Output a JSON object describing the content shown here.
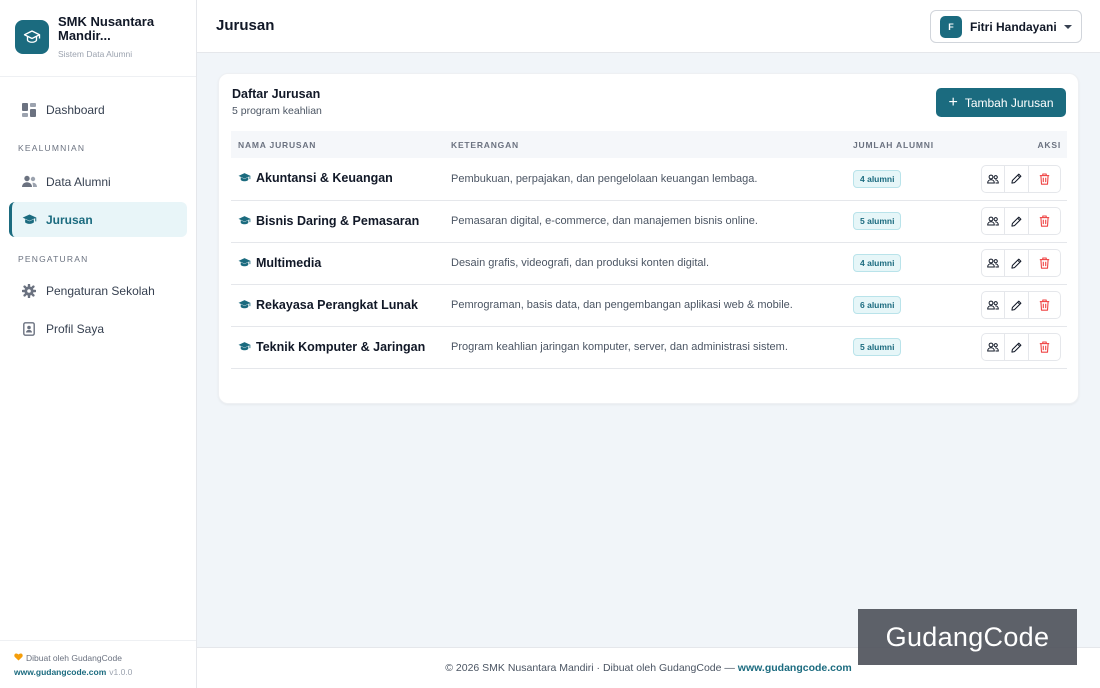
{
  "brand": {
    "name": "SMK Nusantara Mandir...",
    "subtitle": "Sistem Data Alumni"
  },
  "sidebar": {
    "dashboard": "Dashboard",
    "section_alumni": "KEALUMNIAN",
    "data_alumni": "Data Alumni",
    "jurusan": "Jurusan",
    "section_settings": "PENGATURAN",
    "pengaturan_sekolah": "Pengaturan Sekolah",
    "profil_saya": "Profil Saya",
    "footer_made_by": "Dibuat oleh GudangCode",
    "footer_link": "www.gudangcode.com",
    "footer_version": "v1.0.0"
  },
  "header": {
    "title": "Jurusan",
    "user_initial": "F",
    "user_name": "Fitri Handayani"
  },
  "card": {
    "title": "Daftar Jurusan",
    "subtitle": "5 program keahlian",
    "add_label": "Tambah Jurusan"
  },
  "table": {
    "columns": [
      "NAMA JURUSAN",
      "KETERANGAN",
      "JUMLAH ALUMNI",
      "AKSI"
    ],
    "rows": [
      {
        "name": "Akuntansi & Keuangan",
        "desc": "Pembukuan, perpajakan, dan pengelolaan keuangan lembaga.",
        "alumni": "4 alumni"
      },
      {
        "name": "Bisnis Daring & Pemasaran",
        "desc": "Pemasaran digital, e-commerce, dan manajemen bisnis online.",
        "alumni": "5 alumni"
      },
      {
        "name": "Multimedia",
        "desc": "Desain grafis, videografi, dan produksi konten digital.",
        "alumni": "4 alumni"
      },
      {
        "name": "Rekayasa Perangkat Lunak",
        "desc": "Pemrograman, basis data, dan pengembangan aplikasi web & mobile.",
        "alumni": "6 alumni"
      },
      {
        "name": "Teknik Komputer & Jaringan",
        "desc": "Program keahlian jaringan komputer, server, dan administrasi sistem.",
        "alumni": "5 alumni"
      }
    ]
  },
  "footer": {
    "text": "© 2026 SMK Nusantara Mandiri · Dibuat oleh GudangCode — ",
    "link": "www.gudangcode.com"
  },
  "watermark": "GudangCode",
  "colors": {
    "primary": "#1b6b7f",
    "danger": "#ef4444",
    "background": "#f1f5f9"
  },
  "icons": {
    "brand": "graduation-cap-icon",
    "row": "graduation-cap-icon",
    "actions": [
      "users-icon",
      "pencil-icon",
      "trash-icon"
    ]
  }
}
